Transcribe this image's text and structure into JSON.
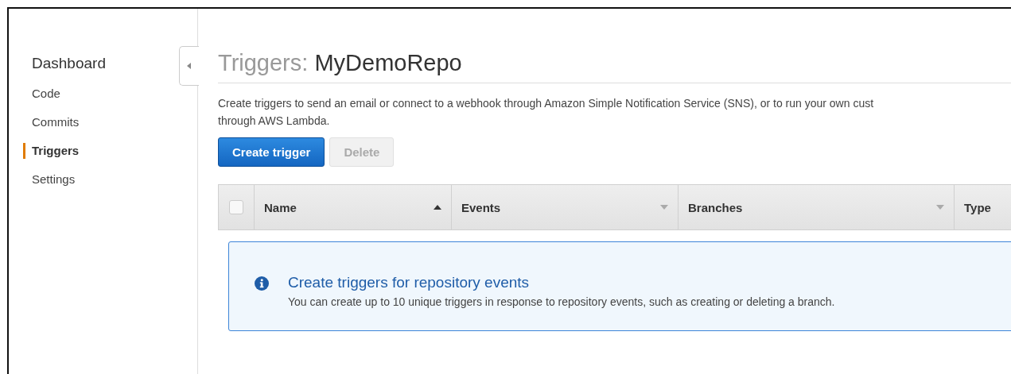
{
  "sidebar": {
    "items": [
      {
        "label": "Dashboard",
        "kind": "heading"
      },
      {
        "label": "Code",
        "kind": "link",
        "selected": false
      },
      {
        "label": "Commits",
        "kind": "link",
        "selected": false
      },
      {
        "label": "Triggers",
        "kind": "link",
        "selected": true
      },
      {
        "label": "Settings",
        "kind": "link",
        "selected": false
      }
    ]
  },
  "page": {
    "title_prefix": "Triggers:",
    "title_name": "MyDemoRepo",
    "description_lines": [
      "Create triggers to send an email or connect to a webhook through Amazon Simple Notification Service (SNS), or to run your own cust",
      "through AWS Lambda."
    ],
    "buttons": [
      {
        "label": "Create trigger",
        "kind": "primary",
        "disabled": false
      },
      {
        "label": "Delete",
        "kind": "default",
        "disabled": true
      }
    ]
  },
  "table": {
    "select_all_checked": false,
    "columns": [
      {
        "label": "Name",
        "sorted": true
      },
      {
        "label": "Events",
        "sorted": false
      },
      {
        "label": "Branches",
        "sorted": false
      },
      {
        "label": "Type"
      }
    ]
  },
  "info": {
    "title": "Create triggers for repository events",
    "text": "You can create up to 10 unique triggers in response to repository events, such as creating or deleting a branch."
  }
}
